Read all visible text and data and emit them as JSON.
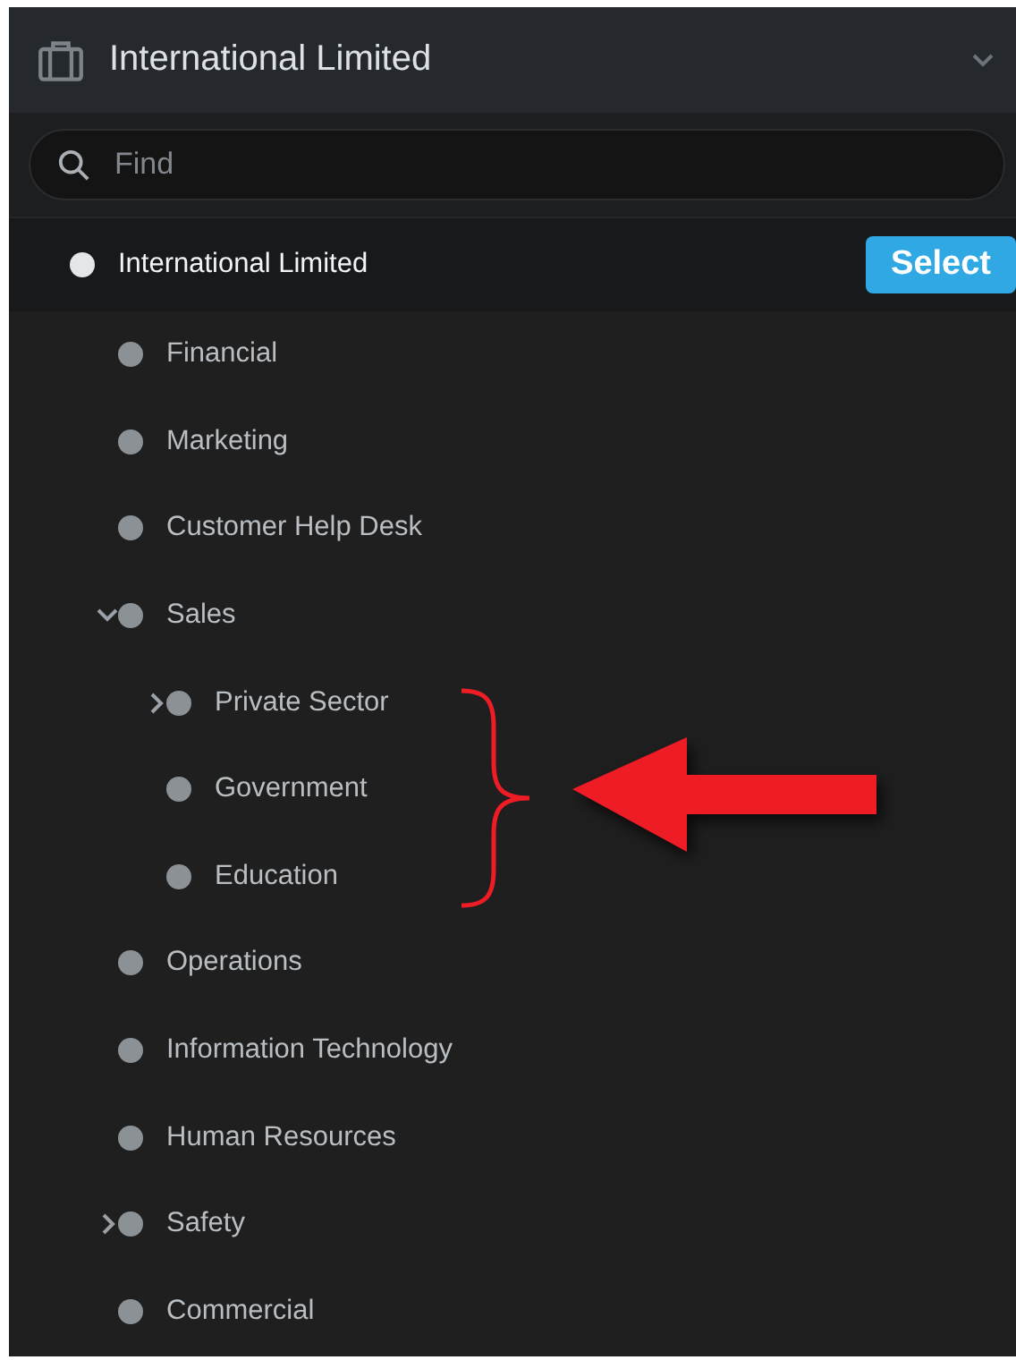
{
  "header": {
    "title": "International Limited"
  },
  "search": {
    "placeholder": "Find"
  },
  "tree": [
    {
      "label": "International Limited",
      "selected": true,
      "action": "Select",
      "children": [
        {
          "label": "Financial",
          "selected": false
        },
        {
          "label": "Marketing",
          "selected": false
        },
        {
          "label": "Customer Help Desk",
          "selected": false
        },
        {
          "label": "Sales",
          "selected": false,
          "expanded": true,
          "children": [
            {
              "label": "Private Sector",
              "selected": false,
              "expanded": false
            },
            {
              "label": "Government",
              "selected": false
            },
            {
              "label": "Education",
              "selected": false
            }
          ]
        },
        {
          "label": "Operations",
          "selected": false
        },
        {
          "label": "Information Technology",
          "selected": false
        },
        {
          "label": "Human Resources",
          "selected": false
        },
        {
          "label": "Safety",
          "selected": false,
          "expanded": false
        },
        {
          "label": "Commercial",
          "selected": false
        }
      ]
    }
  ],
  "annotations": [
    {
      "kind": "brace"
    },
    {
      "kind": "arrow"
    }
  ]
}
